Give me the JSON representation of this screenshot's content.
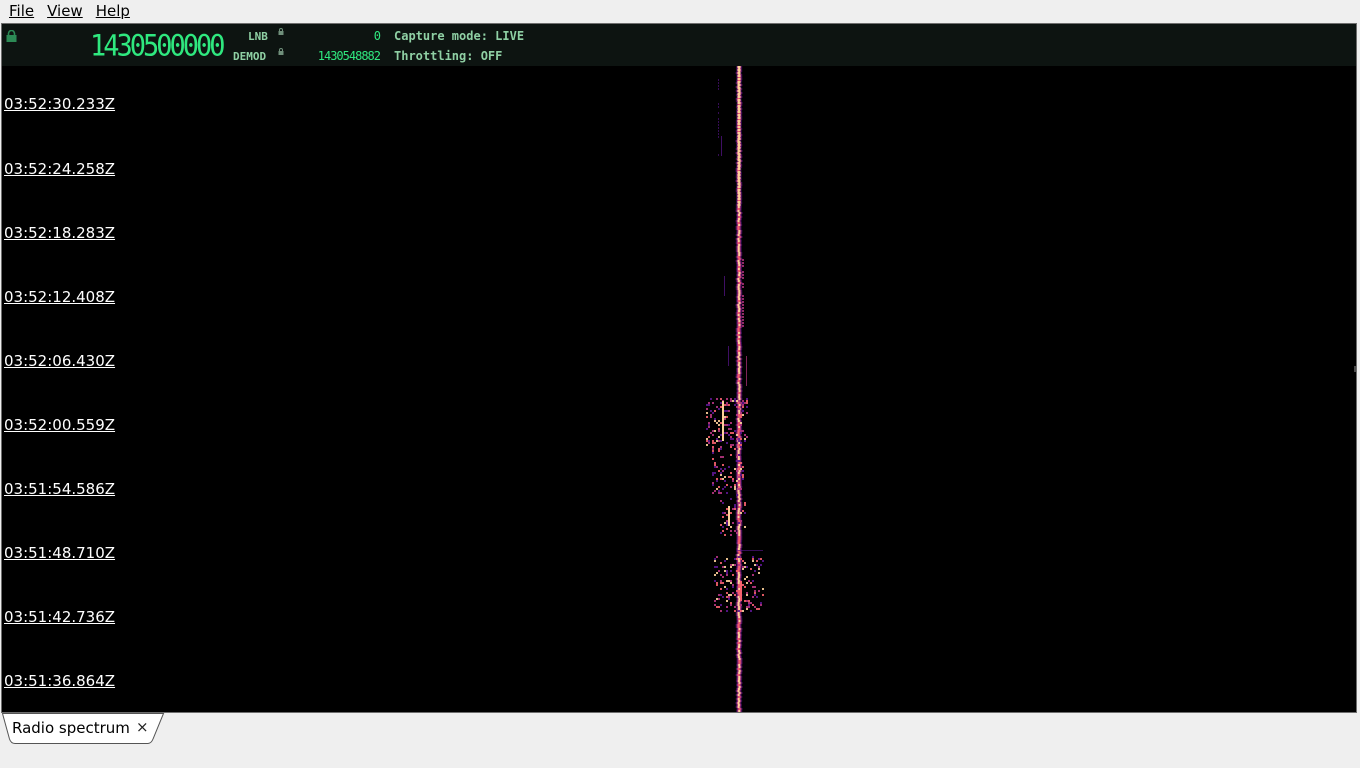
{
  "menu": {
    "items": [
      {
        "label": "File"
      },
      {
        "label": "View"
      },
      {
        "label": "Help"
      }
    ]
  },
  "status": {
    "main_frequency": "1430500000",
    "lnb_label": "LNB",
    "lnb_value": "0",
    "demod_label": "DEMOD",
    "demod_value": "1430548882",
    "capture_mode": "Capture mode: LIVE",
    "throttling": "Throttling: OFF"
  },
  "waterfall": {
    "timestamps": [
      "03:52:30.233Z",
      "03:52:24.258Z",
      "03:52:18.283Z",
      "03:52:12.408Z",
      "03:52:06.430Z",
      "03:52:00.559Z",
      "03:51:54.586Z",
      "03:51:48.710Z",
      "03:51:42.736Z",
      "03:51:36.864Z"
    ],
    "colors": {
      "background": "#000000",
      "signal_core": "#fdd09a",
      "signal_hot": "#f4616d",
      "signal_mid": "#b5357f",
      "signal_low": "#5a168f"
    }
  },
  "tabs": [
    {
      "label": "Radio spectrum",
      "close": "×"
    }
  ],
  "icons": {
    "lock": "lock-icon",
    "close": "close-icon"
  }
}
